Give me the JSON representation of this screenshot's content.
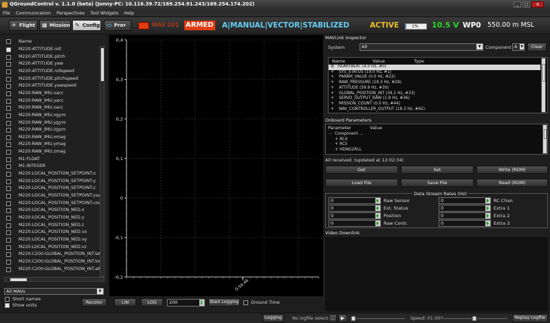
{
  "window": {
    "title": "QGroundControl v. 1.1.0 (beta) (Jonny-PC: 10.116.39.72/169.254.91.243/169.254.174.202)",
    "controls": [
      "_",
      "□",
      "x"
    ]
  },
  "menu": [
    "File",
    "Communication",
    "Perspectives",
    "Tool Widgets",
    "Help"
  ],
  "toolbar": {
    "perspectives": [
      {
        "label": "Flight",
        "icon": "plane-icon",
        "active": false
      },
      {
        "label": "Mission",
        "icon": "map-icon",
        "active": false
      },
      {
        "label": "Config",
        "icon": "wrench-icon",
        "active": true
      },
      {
        "label": "Pro▾",
        "icon": "monitor-icon",
        "active": false
      }
    ],
    "mav_name": "MAV 001",
    "armed": "ARMED",
    "mode_prefix": "A",
    "modes": "|MANUAL|VECTOR|STABILIZED",
    "state": "ACTIVE",
    "battery_percent": 1,
    "battery_text": "1%",
    "voltage": "10.5 V",
    "waypoint": "WP0",
    "altitude": "550.00 m MSL",
    "colors": {
      "armed_bg": "#e23b12",
      "mode": "#64cdf0",
      "active": "#f0c020",
      "voltage": "#2bd62b",
      "mav": "#e23b12"
    }
  },
  "left_panel": {
    "header": "Name",
    "items": [
      {
        "name": "M220:ATTITUDE.roll",
        "checked": true
      },
      {
        "name": "M220:ATTITUDE.pitch",
        "checked": false
      },
      {
        "name": "M220:ATTITUDE.yaw",
        "checked": false
      },
      {
        "name": "M220:ATTITUDE.rollspeed",
        "checked": false
      },
      {
        "name": "M220:ATTITUDE.pitchspeed",
        "checked": false
      },
      {
        "name": "M220:ATTITUDE.yawspeed",
        "checked": false
      },
      {
        "name": "M220:RAW_IMU.xacc",
        "checked": false
      },
      {
        "name": "M220:RAW_IMU.yacc",
        "checked": false
      },
      {
        "name": "M220:RAW_IMU.zacc",
        "checked": false
      },
      {
        "name": "M220:RAW_IMU.xgyro",
        "checked": false
      },
      {
        "name": "M220:RAW_IMU.ygyro",
        "checked": false
      },
      {
        "name": "M220:RAW_IMU.zgyro",
        "checked": false
      },
      {
        "name": "M220:RAW_IMU.xmag",
        "checked": false
      },
      {
        "name": "M220:RAW_IMU.ymag",
        "checked": false
      },
      {
        "name": "M220:RAW_IMU.zmag",
        "checked": false
      },
      {
        "name": "M1:FLOAT",
        "checked": false
      },
      {
        "name": "M1:INTEGER",
        "checked": false
      },
      {
        "name": "M220:LOCAL_POSITION_SETPOINT.x",
        "checked": false
      },
      {
        "name": "M220:LOCAL_POSITION_SETPOINT.y",
        "checked": false
      },
      {
        "name": "M220:LOCAL_POSITION_SETPOINT.z",
        "checked": false
      },
      {
        "name": "M220:LOCAL_POSITION_SETPOINT.yaw",
        "checked": false
      },
      {
        "name": "M220:LOCAL_POSITION_SETPOINT.coo",
        "checked": false
      },
      {
        "name": "M220:LOCAL_POSITION_NED.x",
        "checked": false
      },
      {
        "name": "M220:LOCAL_POSITION_NED.y",
        "checked": false
      },
      {
        "name": "M220:LOCAL_POSITION_NED.z",
        "checked": false
      },
      {
        "name": "M220:LOCAL_POSITION_NED.vx",
        "checked": false
      },
      {
        "name": "M220:LOCAL_POSITION_NED.vy",
        "checked": false
      },
      {
        "name": "M220:LOCAL_POSITION_NED.vz",
        "checked": false
      },
      {
        "name": "M220:C200:GLOBAL_POSITION_INT.lat",
        "checked": false
      },
      {
        "name": "M220:C200:GLOBAL_POSITION_INT.lon",
        "checked": false
      },
      {
        "name": "M220:C200:GLOBAL_POSITION_INT.alt",
        "checked": false
      }
    ],
    "mav_filter": "All MAVs",
    "short_names": "Short names",
    "show_units": "Show units",
    "short_names_checked": false,
    "show_units_checked": true,
    "recolor": "Recolor"
  },
  "plot": {
    "chart_data": {
      "type": "line",
      "y_ticks": [
        "0,4",
        "0,3",
        "0,2",
        "0,1",
        "0",
        "-0,1",
        "-0,2"
      ],
      "x_tick": "0:54:46",
      "ylim": [
        -0.2,
        0.4
      ],
      "grid": true,
      "series": []
    },
    "lin": "LIN",
    "log": "LOG",
    "time_window": "200",
    "start_logging": "Start Logging",
    "ground_time": "Ground Time"
  },
  "mavlink_inspector": {
    "title": "MAVLink Inspector",
    "system_label": "System",
    "system_value": "All",
    "component_label": "Component",
    "component_value": "A",
    "clear": "Clear",
    "columns": [
      "Name",
      "Value",
      "Type"
    ],
    "messages": [
      "HEARTBEAT (4.0 Hz, #0)",
      "SYS_STATUS (19.0 Hz, #1)",
      "PARAM_VALUE (0.0 Hz, #22)",
      "RAW_PRESSURE (18.3 Hz, #29)",
      "ATTITUDE (59.9 Hz, #30)",
      "GLOBAL_POSITION_INT (34.1 Hz, #33)",
      "SERVO_OUTPUT_RAW (1.8 Hz, #36)",
      "MISSION_COUNT (0.0 Hz, #44)",
      "NAV_CONTROLLER_OUTPUT (18.3 Hz, #62)"
    ]
  },
  "onboard_params": {
    "title": "Onboard Parameters",
    "columns": [
      "Parameter",
      "Value"
    ],
    "rows": [
      "Component ...",
      "RC4",
      "RC5",
      "HDNG2RLL"
    ],
    "status": "All received. (updated at 12:02:34)",
    "buttons": [
      "Get",
      "Set",
      "Write (ROM)",
      "Load File",
      "Save File",
      "Read (ROM)"
    ]
  },
  "stream_rates": {
    "title": "Data Stream Rates (Hz)",
    "rows": [
      {
        "left_value": "0",
        "left_label": "Raw Sensor",
        "right_value": "0",
        "right_label": "RC Chan."
      },
      {
        "left_value": "0",
        "left_label": "Ext. Status",
        "right_value": "0",
        "right_label": "Extra 1"
      },
      {
        "left_value": "0",
        "left_label": "Position",
        "right_value": "0",
        "right_label": "Extra 2"
      },
      {
        "left_value": "0",
        "left_label": "Raw Contr.",
        "right_value": "0",
        "right_label": "Extra 3"
      }
    ]
  },
  "video": {
    "title": "Video Downlink"
  },
  "statusbar": {
    "logging": "Logging",
    "logfile": "No logfile selected..",
    "ellipsis": "...",
    "speed": "Speed: 01.00X",
    "replay": "Replay Logfile",
    "playback_position": 0
  }
}
